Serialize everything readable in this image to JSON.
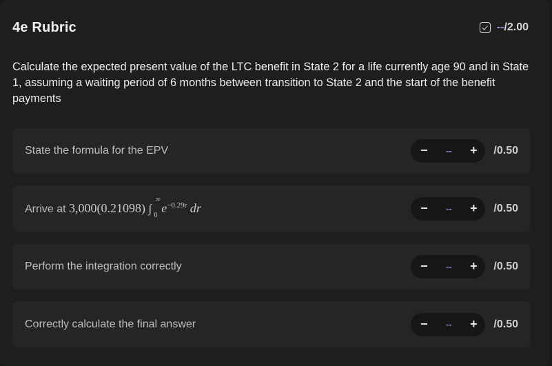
{
  "header": {
    "title": "4e Rubric",
    "score_value": "--",
    "score_max": "/2.00"
  },
  "prompt": "Calculate the expected present value of the LTC benefit in State 2 for a life currently age 90 and in State 1, assuming a waiting period of 6 months between transition to State 2 and the start of the benefit payments",
  "items": [
    {
      "label": "State the formula for the EPV",
      "minus": "−",
      "value": "--",
      "plus": "+",
      "max": "/0.50"
    },
    {
      "label": "Arrive at",
      "math": {
        "coef": "3,000(0.21098)",
        "integral": "∫",
        "upper": "∞",
        "lower": "0",
        "base": "e",
        "exponent": "−0.29r",
        "differential": "dr"
      },
      "minus": "−",
      "value": "--",
      "plus": "+",
      "max": "/0.50"
    },
    {
      "label": "Perform the integration correctly",
      "minus": "−",
      "value": "--",
      "plus": "+",
      "max": "/0.50"
    },
    {
      "label": "Correctly calculate the final answer",
      "minus": "−",
      "value": "--",
      "plus": "+",
      "max": "/0.50"
    }
  ]
}
